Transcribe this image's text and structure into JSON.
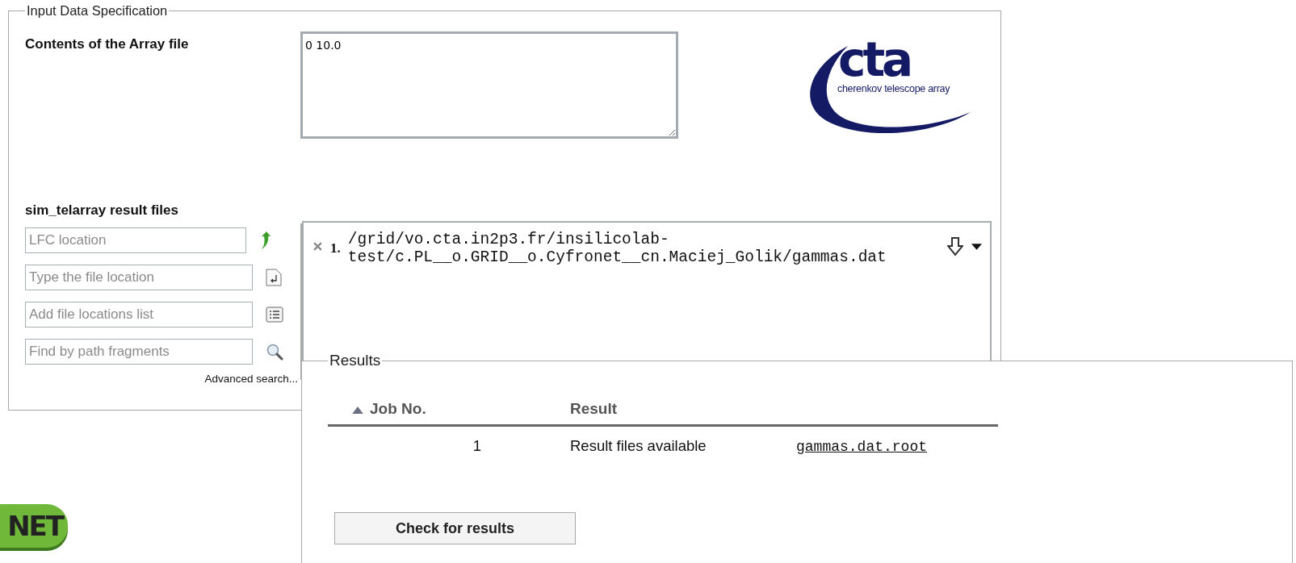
{
  "input_section": {
    "legend": "Input Data Specification",
    "array_file": {
      "label": "Contents of the Array file",
      "value": "0 10.0"
    },
    "logo": {
      "wordmark": "cta",
      "tagline": "cherenkov telescope array"
    },
    "result_files": {
      "label": "sim_telarray result files",
      "fields": [
        {
          "kind": "lfc",
          "placeholder": "LFC location"
        },
        {
          "kind": "type",
          "placeholder": "Type the file location"
        },
        {
          "kind": "list",
          "placeholder": "Add file locations list"
        },
        {
          "kind": "search",
          "placeholder": "Find by path fragments"
        }
      ],
      "advanced_link": "Advanced search...",
      "files": [
        {
          "number": "1.",
          "path": "/grid/vo.cta.in2p3.fr/insilicolab-test/c.PL__o.GRID__o.Cyfronet__cn.Maciej_Golik/gammas.dat"
        }
      ]
    }
  },
  "results": {
    "legend": "Results",
    "columns": [
      {
        "label": "Job No.",
        "sorted": true
      },
      {
        "label": "Result",
        "sorted": false
      }
    ],
    "rows": [
      {
        "job": "1",
        "result": "Result files available",
        "file": "gammas.dat.root"
      }
    ],
    "button": "Check for results"
  },
  "footer_logo": {
    "text": "NET"
  }
}
